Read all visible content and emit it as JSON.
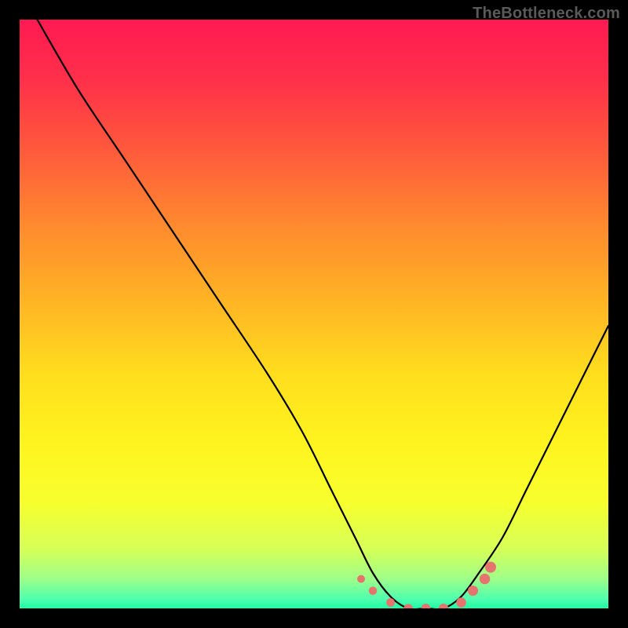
{
  "watermark": "TheBottleneck.com",
  "colors": {
    "frame": "#000000",
    "curve": "#000000",
    "marker_fill": "#e6746e",
    "marker_stroke": "#e6746e",
    "watermark": "#5a5a5a"
  },
  "chart_data": {
    "type": "line",
    "title": "",
    "xlabel": "",
    "ylabel": "",
    "xlim": [
      0,
      100
    ],
    "ylim": [
      0,
      100
    ],
    "grid": false,
    "legend": false,
    "gradient_stops": [
      {
        "offset": 0.0,
        "color": "#ff1a52"
      },
      {
        "offset": 0.1,
        "color": "#ff2f4a"
      },
      {
        "offset": 0.22,
        "color": "#ff593c"
      },
      {
        "offset": 0.35,
        "color": "#ff8a2e"
      },
      {
        "offset": 0.48,
        "color": "#ffb524"
      },
      {
        "offset": 0.6,
        "color": "#ffdd1e"
      },
      {
        "offset": 0.72,
        "color": "#fff41f"
      },
      {
        "offset": 0.82,
        "color": "#f7ff2e"
      },
      {
        "offset": 0.9,
        "color": "#d6ff58"
      },
      {
        "offset": 0.95,
        "color": "#9eff8a"
      },
      {
        "offset": 0.985,
        "color": "#4dffb0"
      },
      {
        "offset": 1.0,
        "color": "#1fffa3"
      }
    ],
    "series": [
      {
        "name": "bottleneck-curve",
        "x": [
          3,
          10,
          18,
          26,
          34,
          42,
          48,
          53,
          57,
          60,
          63,
          66,
          69,
          72,
          75,
          78,
          82,
          86,
          90,
          94,
          98,
          100
        ],
        "y": [
          100,
          88,
          76,
          64,
          52,
          40,
          30,
          20,
          12,
          6,
          2,
          0,
          0,
          0,
          2,
          6,
          12,
          20,
          28,
          36,
          44,
          48
        ]
      }
    ],
    "markers": {
      "name": "highlight-region",
      "points": [
        {
          "x": 58,
          "y": 5
        },
        {
          "x": 60,
          "y": 3
        },
        {
          "x": 63,
          "y": 1
        },
        {
          "x": 66,
          "y": 0
        },
        {
          "x": 69,
          "y": 0
        },
        {
          "x": 72,
          "y": 0
        },
        {
          "x": 75,
          "y": 1
        },
        {
          "x": 77,
          "y": 3
        },
        {
          "x": 79,
          "y": 5
        },
        {
          "x": 80,
          "y": 7
        }
      ],
      "radius_start": 5,
      "radius_end": 7
    }
  }
}
